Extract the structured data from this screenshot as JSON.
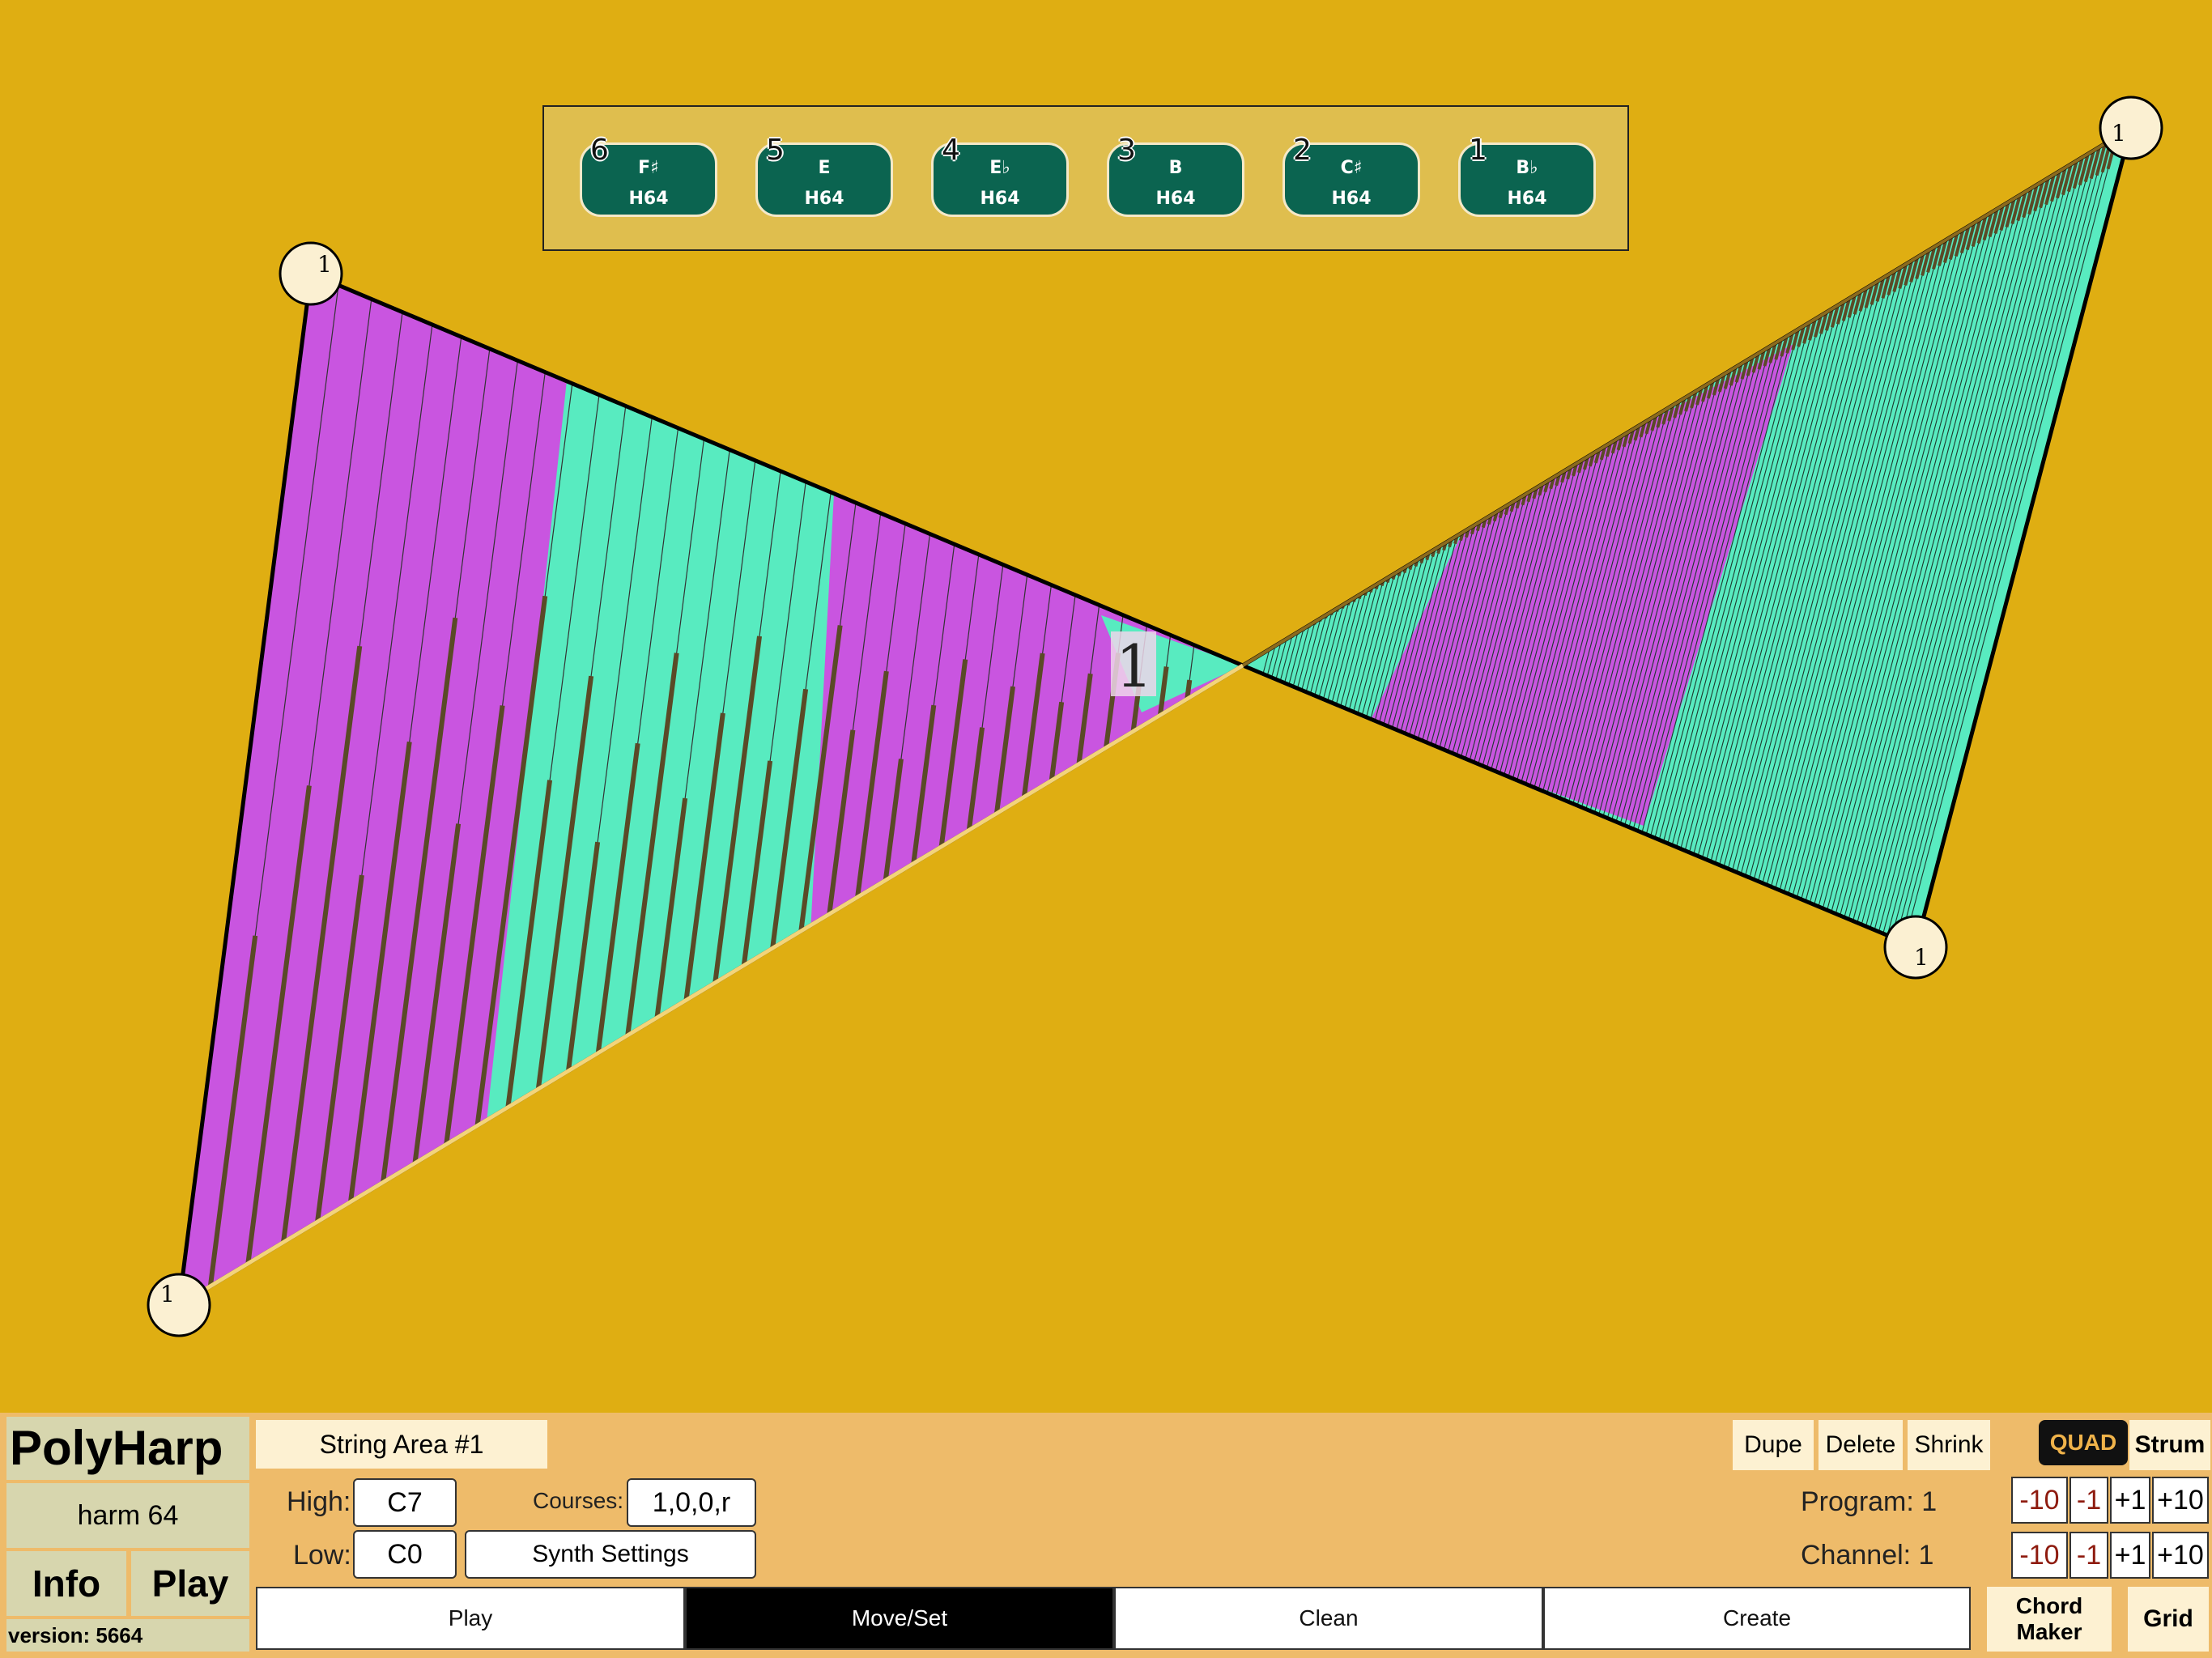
{
  "app": {
    "name": "PolyHarp",
    "preset": "harm 64",
    "version": "version: 5664"
  },
  "canvas": {
    "corner_label": "1",
    "center_label": "1",
    "colors": {
      "purple": "#C955E0",
      "teal": "#58EBC0",
      "string": "#5A4A27",
      "background": "#DFAE12"
    }
  },
  "chords": [
    {
      "num": "6",
      "name": "F♯",
      "type": "H64"
    },
    {
      "num": "5",
      "name": "E",
      "type": "H64"
    },
    {
      "num": "4",
      "name": "E♭",
      "type": "H64"
    },
    {
      "num": "3",
      "name": "B",
      "type": "H64"
    },
    {
      "num": "2",
      "name": "C♯",
      "type": "H64"
    },
    {
      "num": "1",
      "name": "B♭",
      "type": "H64"
    }
  ],
  "nav": {
    "info": "Info",
    "play": "Play"
  },
  "area": {
    "name": "String Area #1",
    "high_label": "High:",
    "high_value": "C7",
    "low_label": "Low:",
    "low_value": "C0",
    "courses_label": "Courses:",
    "courses_value": "1,0,0,r",
    "synth_settings": "Synth Settings"
  },
  "tools": {
    "dupe": "Dupe",
    "delete": "Delete",
    "shrink": "Shrink",
    "quad": "QUAD",
    "strum": "Strum"
  },
  "program": {
    "label": "Program: 1"
  },
  "channel": {
    "label": "Channel: 1"
  },
  "steppers": {
    "m10": "-10",
    "m1": "-1",
    "p1": "+1",
    "p10": "+10"
  },
  "modes": [
    {
      "label": "Play",
      "active": false
    },
    {
      "label": "Move/Set",
      "active": true
    },
    {
      "label": "Clean",
      "active": false
    },
    {
      "label": "Create",
      "active": false
    }
  ],
  "chord_maker": "Chord Maker",
  "grid": "Grid"
}
